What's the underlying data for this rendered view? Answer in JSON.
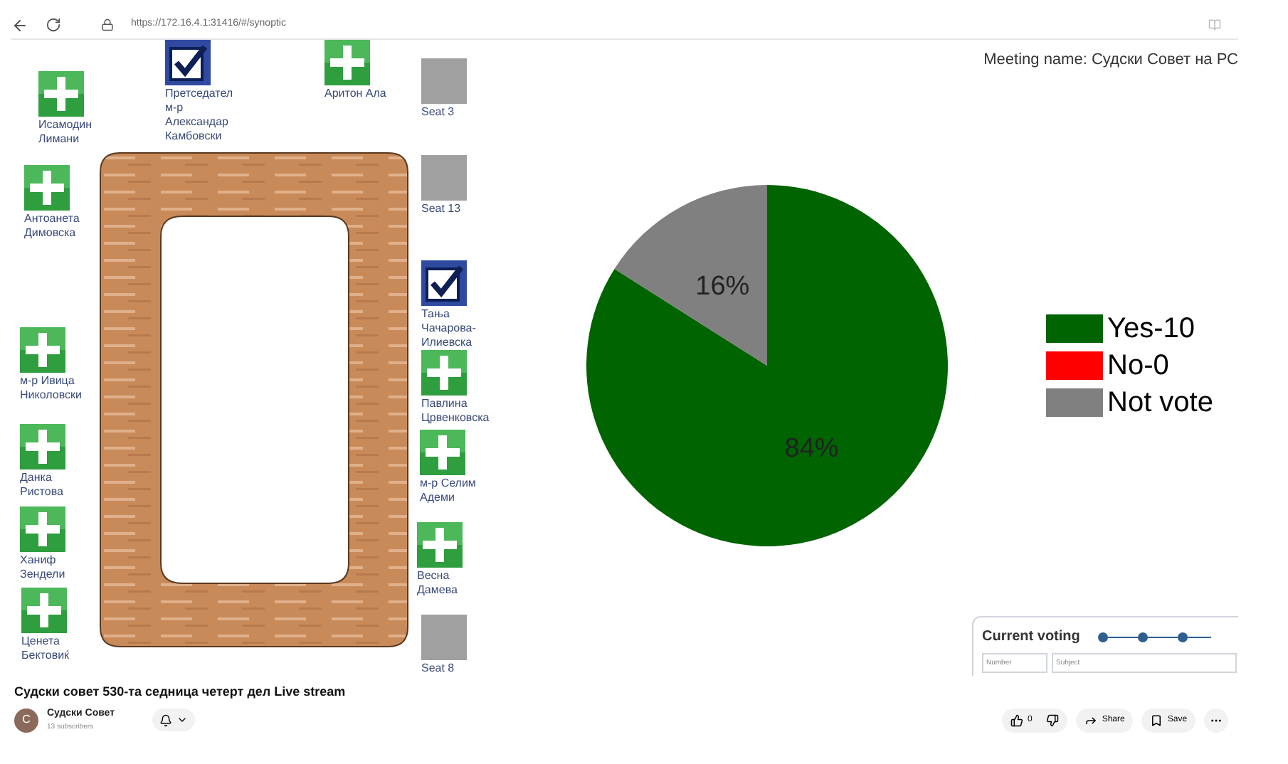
{
  "browser": {
    "url": "https://172.16.4.1:31416/#/synoptic"
  },
  "meeting_name": "Meeting name: Судски Совет на РС",
  "seats": [
    {
      "kind": "present",
      "label": "Исамодин Лимани"
    },
    {
      "kind": "voted",
      "label": "Претседател м-р Александар Камбовски"
    },
    {
      "kind": "present",
      "label": "Аритон Ала"
    },
    {
      "kind": "empty",
      "label": "Seat 3"
    },
    {
      "kind": "present",
      "label": "Антоанета Димовска"
    },
    {
      "kind": "empty",
      "label": "Seat 13"
    },
    {
      "kind": "voted",
      "label": "Тања Чачарова-Илиевска"
    },
    {
      "kind": "present",
      "label": "м-р Ивица Николовски"
    },
    {
      "kind": "present",
      "label": "Павлина Црвенковска"
    },
    {
      "kind": "present",
      "label": "Данка Ристова"
    },
    {
      "kind": "present",
      "label": "м-р Селим Адеми"
    },
    {
      "kind": "present",
      "label": "Ханиф Зендели"
    },
    {
      "kind": "present",
      "label": "Весна Дамева"
    },
    {
      "kind": "present",
      "label": "Ценета Бектовиќ"
    },
    {
      "kind": "empty",
      "label": "Seat 8"
    }
  ],
  "chart": {
    "chart_data": {
      "type": "pie",
      "categories": [
        "Yes-10",
        "No-0",
        "Not vote"
      ],
      "values": [
        84,
        0,
        16
      ],
      "value_labels": [
        "84%",
        null,
        "16%"
      ],
      "colors": [
        "#006400",
        "#ff0000",
        "#808080"
      ]
    }
  },
  "current_voting": {
    "title": "Current voting",
    "fields": [
      {
        "placeholder": "Number"
      },
      {
        "placeholder": "Subject"
      }
    ]
  },
  "video": {
    "title": "Судски совет 530-та седница четерт дел Live stream",
    "channel": "Судски Совет",
    "avatar": "C",
    "subscribers": "13 subscribers",
    "likes": "0",
    "actions": [
      "Share",
      "Save"
    ]
  }
}
